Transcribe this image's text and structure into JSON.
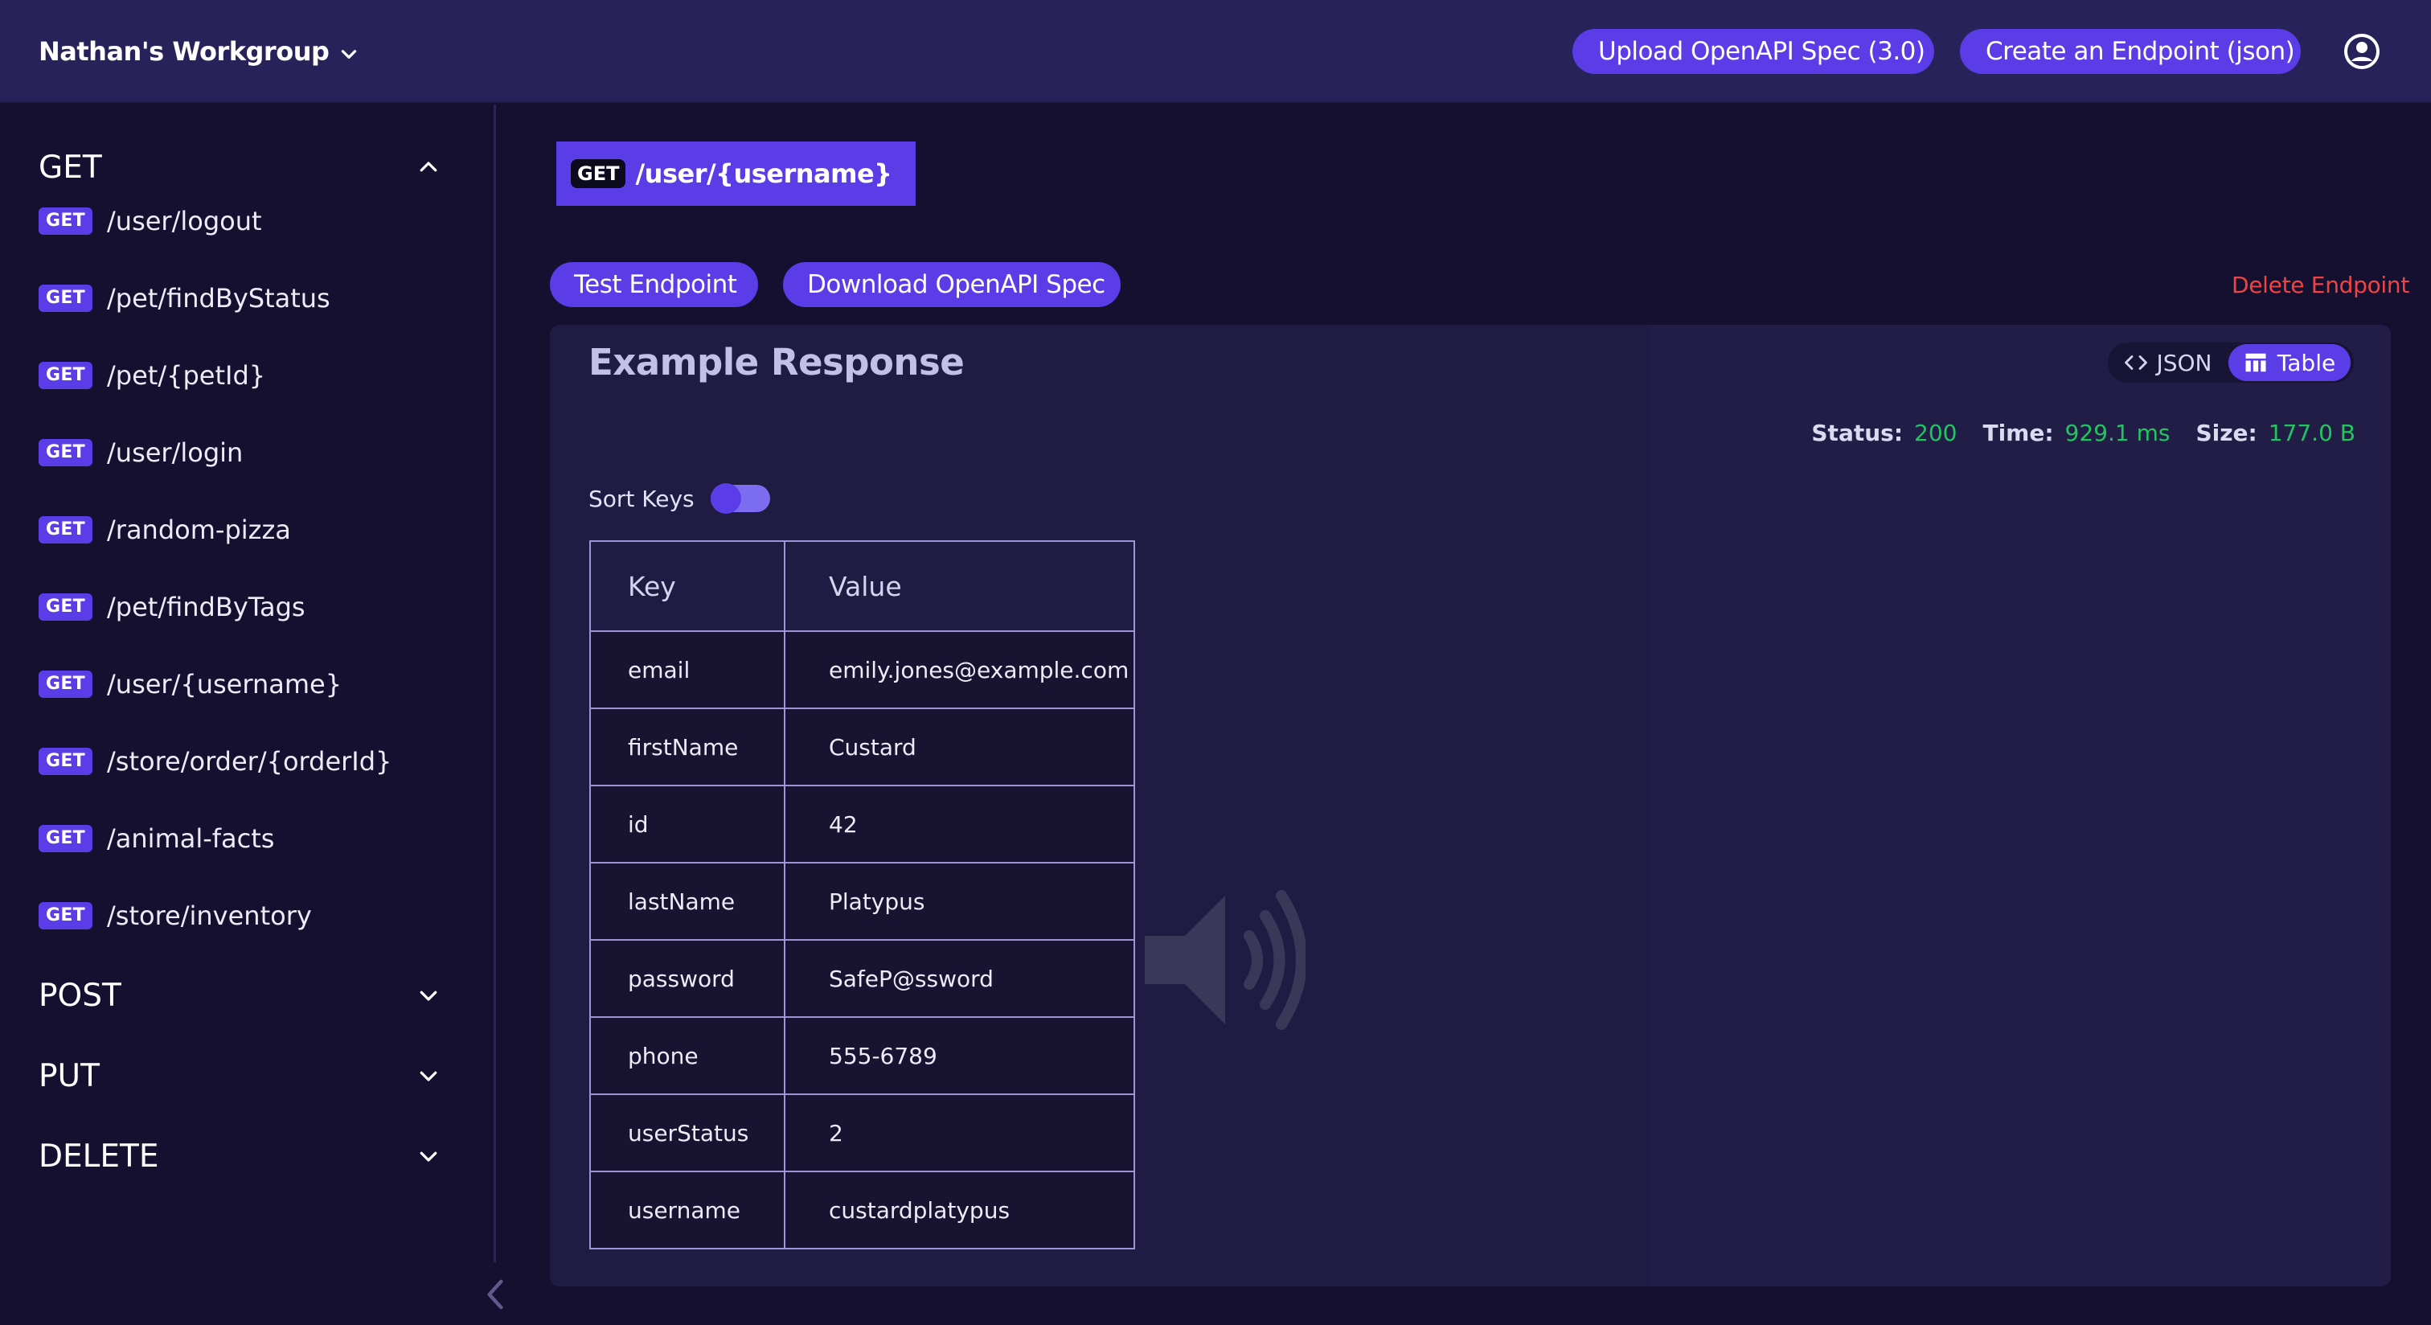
{
  "header": {
    "workgroup": "Nathan's Workgroup",
    "upload_label": "Upload OpenAPI Spec (3.0)",
    "create_label": "Create an Endpoint (json)"
  },
  "sidebar": {
    "groups": {
      "get": "GET",
      "post": "POST",
      "put": "PUT",
      "delete": "DELETE"
    },
    "badge": "GET",
    "endpoints": [
      "/user/logout",
      "/pet/findByStatus",
      "/pet/{petId}",
      "/user/login",
      "/random-pizza",
      "/pet/findByTags",
      "/user/{username}",
      "/store/order/{orderId}",
      "/animal-facts",
      "/store/inventory"
    ]
  },
  "tab": {
    "method": "GET",
    "path": "/user/{username}"
  },
  "actions": {
    "test": "Test Endpoint",
    "download": "Download OpenAPI Spec",
    "delete": "Delete Endpoint"
  },
  "response": {
    "title": "Example Response",
    "view_json": "JSON",
    "view_table": "Table",
    "status_label": "Status:",
    "status_value": "200",
    "time_label": "Time:",
    "time_value": "929.1 ms",
    "size_label": "Size:",
    "size_value": "177.0 B",
    "sort_label": "Sort Keys",
    "sort_keys_enabled": true,
    "table": {
      "headers": [
        "Key",
        "Value"
      ],
      "rows": [
        [
          "email",
          "emily.jones@example.com"
        ],
        [
          "firstName",
          "Custard"
        ],
        [
          "id",
          "42"
        ],
        [
          "lastName",
          "Platypus"
        ],
        [
          "password",
          "SafeP@ssword"
        ],
        [
          "phone",
          "555-6789"
        ],
        [
          "userStatus",
          "2"
        ],
        [
          "username",
          "custardplatypus"
        ]
      ]
    }
  },
  "colors": {
    "accent": "#5a3de6",
    "success": "#22c55e",
    "danger": "#ef4444",
    "header_bg": "#27225a",
    "page_bg": "#151030"
  },
  "icons": {
    "workgroup_menu": "chevron-down-icon",
    "account": "account-circle-icon",
    "group_expanded": "chevron-up-icon",
    "group_collapsed": "chevron-down-icon",
    "close_tab": "close-icon",
    "json_view": "code-icon",
    "table_view": "table-icon",
    "connection": "wifi-icon",
    "collapse_sidebar": "chevron-left-icon"
  }
}
